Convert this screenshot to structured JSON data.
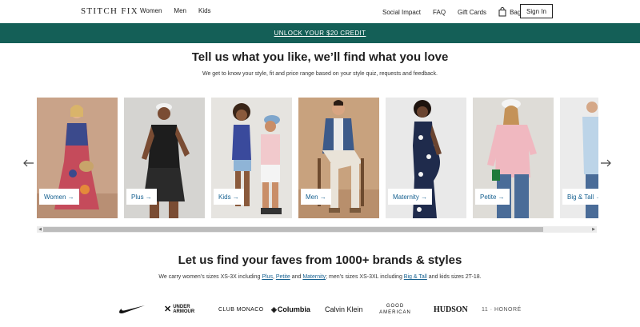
{
  "header": {
    "logo": "STITCH FIX",
    "nav_left": [
      "Women",
      "Men",
      "Kids"
    ],
    "nav_right": [
      "Social Impact",
      "FAQ",
      "Gift Cards"
    ],
    "bag_label": "Bag",
    "signin_label": "Sign In"
  },
  "banner": {
    "text": "UNLOCK YOUR $20 CREDIT"
  },
  "hero": {
    "title": "Tell us what you like, we’ll find what you love",
    "subtitle": "We get to know your style, fit and price range based on your style quiz, requests and feedback."
  },
  "carousel": {
    "prev_icon": "arrow-left-icon",
    "next_icon": "arrow-right-icon",
    "cards": [
      {
        "label": "Women →",
        "bg": "#c9a389"
      },
      {
        "label": "Plus →",
        "bg": "#d5d4d1"
      },
      {
        "label": "Kids →",
        "bg": "#e6e4e0"
      },
      {
        "label": "Men →",
        "bg": "#c8a27e"
      },
      {
        "label": "Maternity →",
        "bg": "#e9e9e9"
      },
      {
        "label": "Petite →",
        "bg": "#dedcd7"
      },
      {
        "label": "Big & Tall →",
        "bg": "#ebebeb"
      }
    ]
  },
  "brands": {
    "title": "Let us find your faves from 1000+ brands & styles",
    "sub_prefix": "We carry women’s sizes XS-3X including ",
    "link_plus": "Plus",
    "sep1": ", ",
    "link_petite": "Petite",
    "sep2": " and ",
    "link_maternity": "Maternity",
    "sub_mid": "; men’s sizes XS-3XL including ",
    "link_bigtall": "Big & Tall",
    "sub_suffix": " and kids sizes 2T-18.",
    "logos": [
      "NIKE",
      "UNDER ARMOUR",
      "CLUB MONACO",
      "Columbia",
      "Calvin Klein",
      "GOOD AMERICAN",
      "HUDSON",
      "11 · HONORÉ"
    ]
  },
  "colors": {
    "accent": "#145f57",
    "link": "#145f8f"
  }
}
